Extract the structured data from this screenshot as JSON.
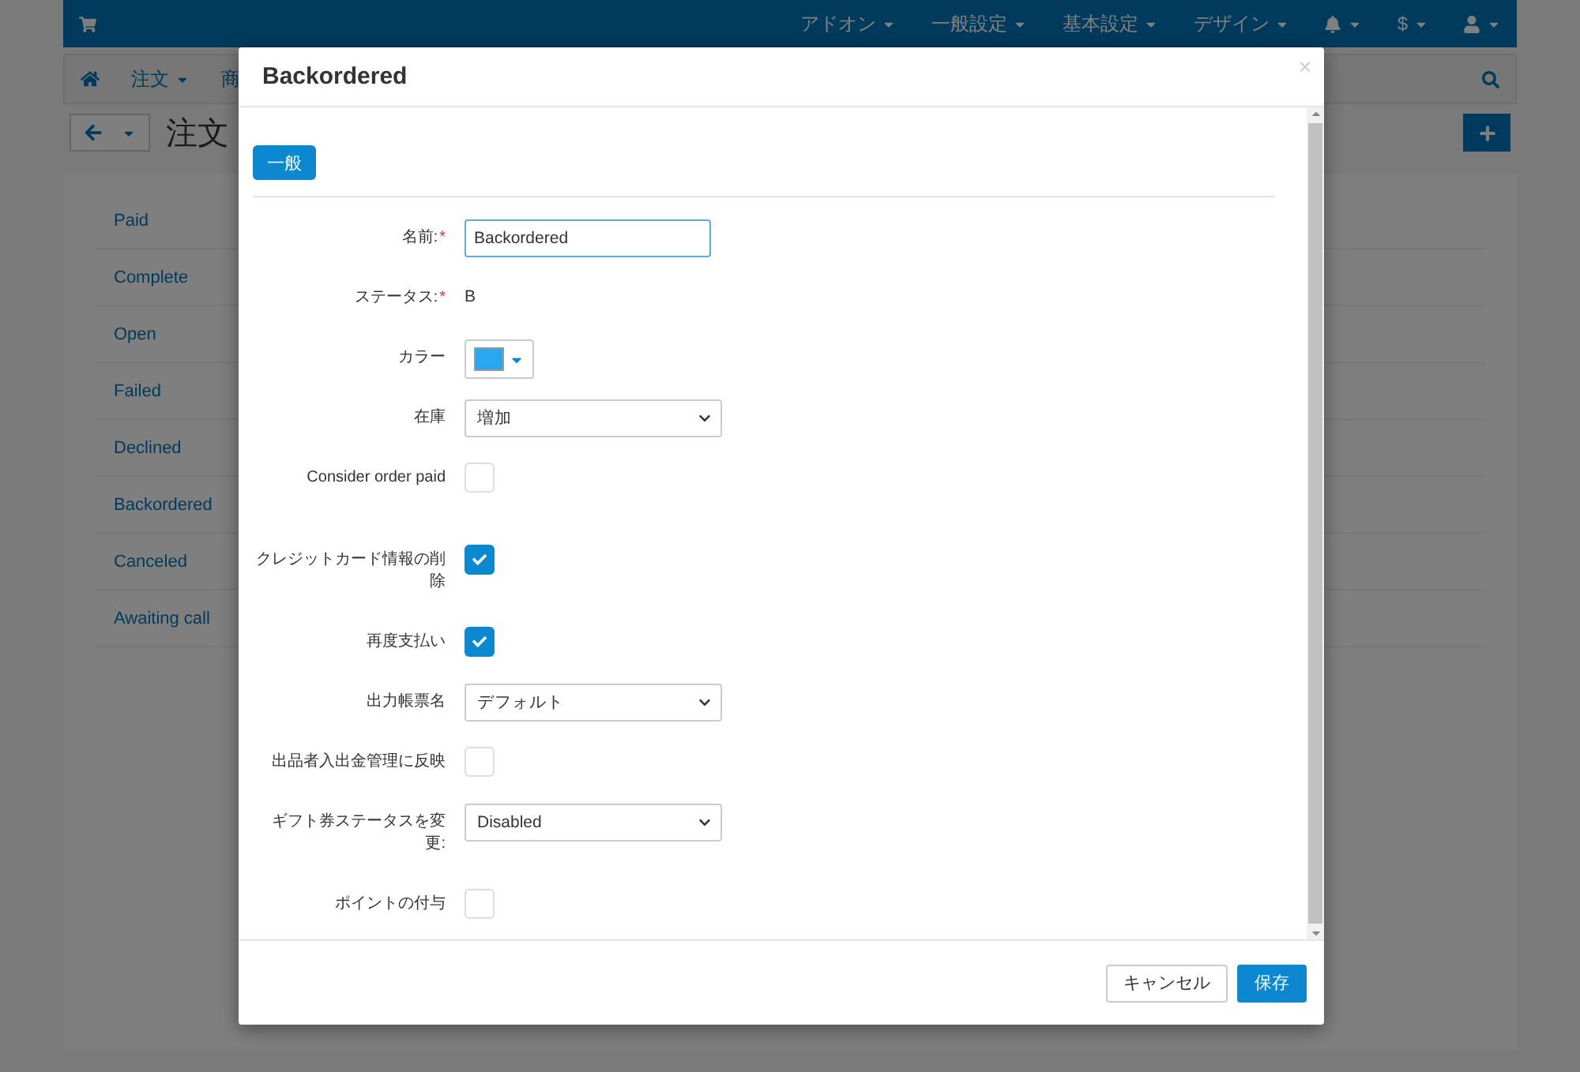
{
  "navbar": {
    "items": [
      "アドオン",
      "一般設定",
      "基本設定",
      "デザイン"
    ],
    "currency": "$"
  },
  "breadcrumb": {
    "items": [
      "注文",
      "商"
    ]
  },
  "page": {
    "title": "注文"
  },
  "statuses": [
    "Paid",
    "Complete",
    "Open",
    "Failed",
    "Declined",
    "Backordered",
    "Canceled",
    "Awaiting call"
  ],
  "modal": {
    "title": "Backordered",
    "close": "×",
    "tabs": [
      {
        "label": "一般",
        "selected": true
      }
    ],
    "fields": [
      {
        "kind": "input",
        "label": "名前:",
        "required_mark": "*",
        "value": "Backordered"
      },
      {
        "kind": "text",
        "label": "ステータス:",
        "required_mark": "*",
        "value": "B"
      },
      {
        "kind": "color",
        "label": "カラー",
        "color": "#29a8ef"
      },
      {
        "kind": "select",
        "label": "在庫",
        "value": "増加"
      },
      {
        "kind": "checkbox",
        "label": "Consider order paid",
        "checked": false
      },
      {
        "kind": "checkbox",
        "label": "クレジットカード情報の削除",
        "checked": true
      },
      {
        "kind": "checkbox",
        "label": "再度支払い",
        "checked": true
      },
      {
        "kind": "select",
        "label": "出力帳票名",
        "value": "デフォルト"
      },
      {
        "kind": "checkbox",
        "label": "出品者入出金管理に反映",
        "checked": false
      },
      {
        "kind": "select",
        "label": "ギフト券ステータスを変更:",
        "value": "Disabled"
      },
      {
        "kind": "checkbox",
        "label": "ポイントの付与",
        "checked": false
      }
    ],
    "buttons": [
      {
        "label": "キャンセル",
        "kind": "secondary"
      },
      {
        "label": "保存",
        "kind": "primary"
      }
    ]
  }
}
